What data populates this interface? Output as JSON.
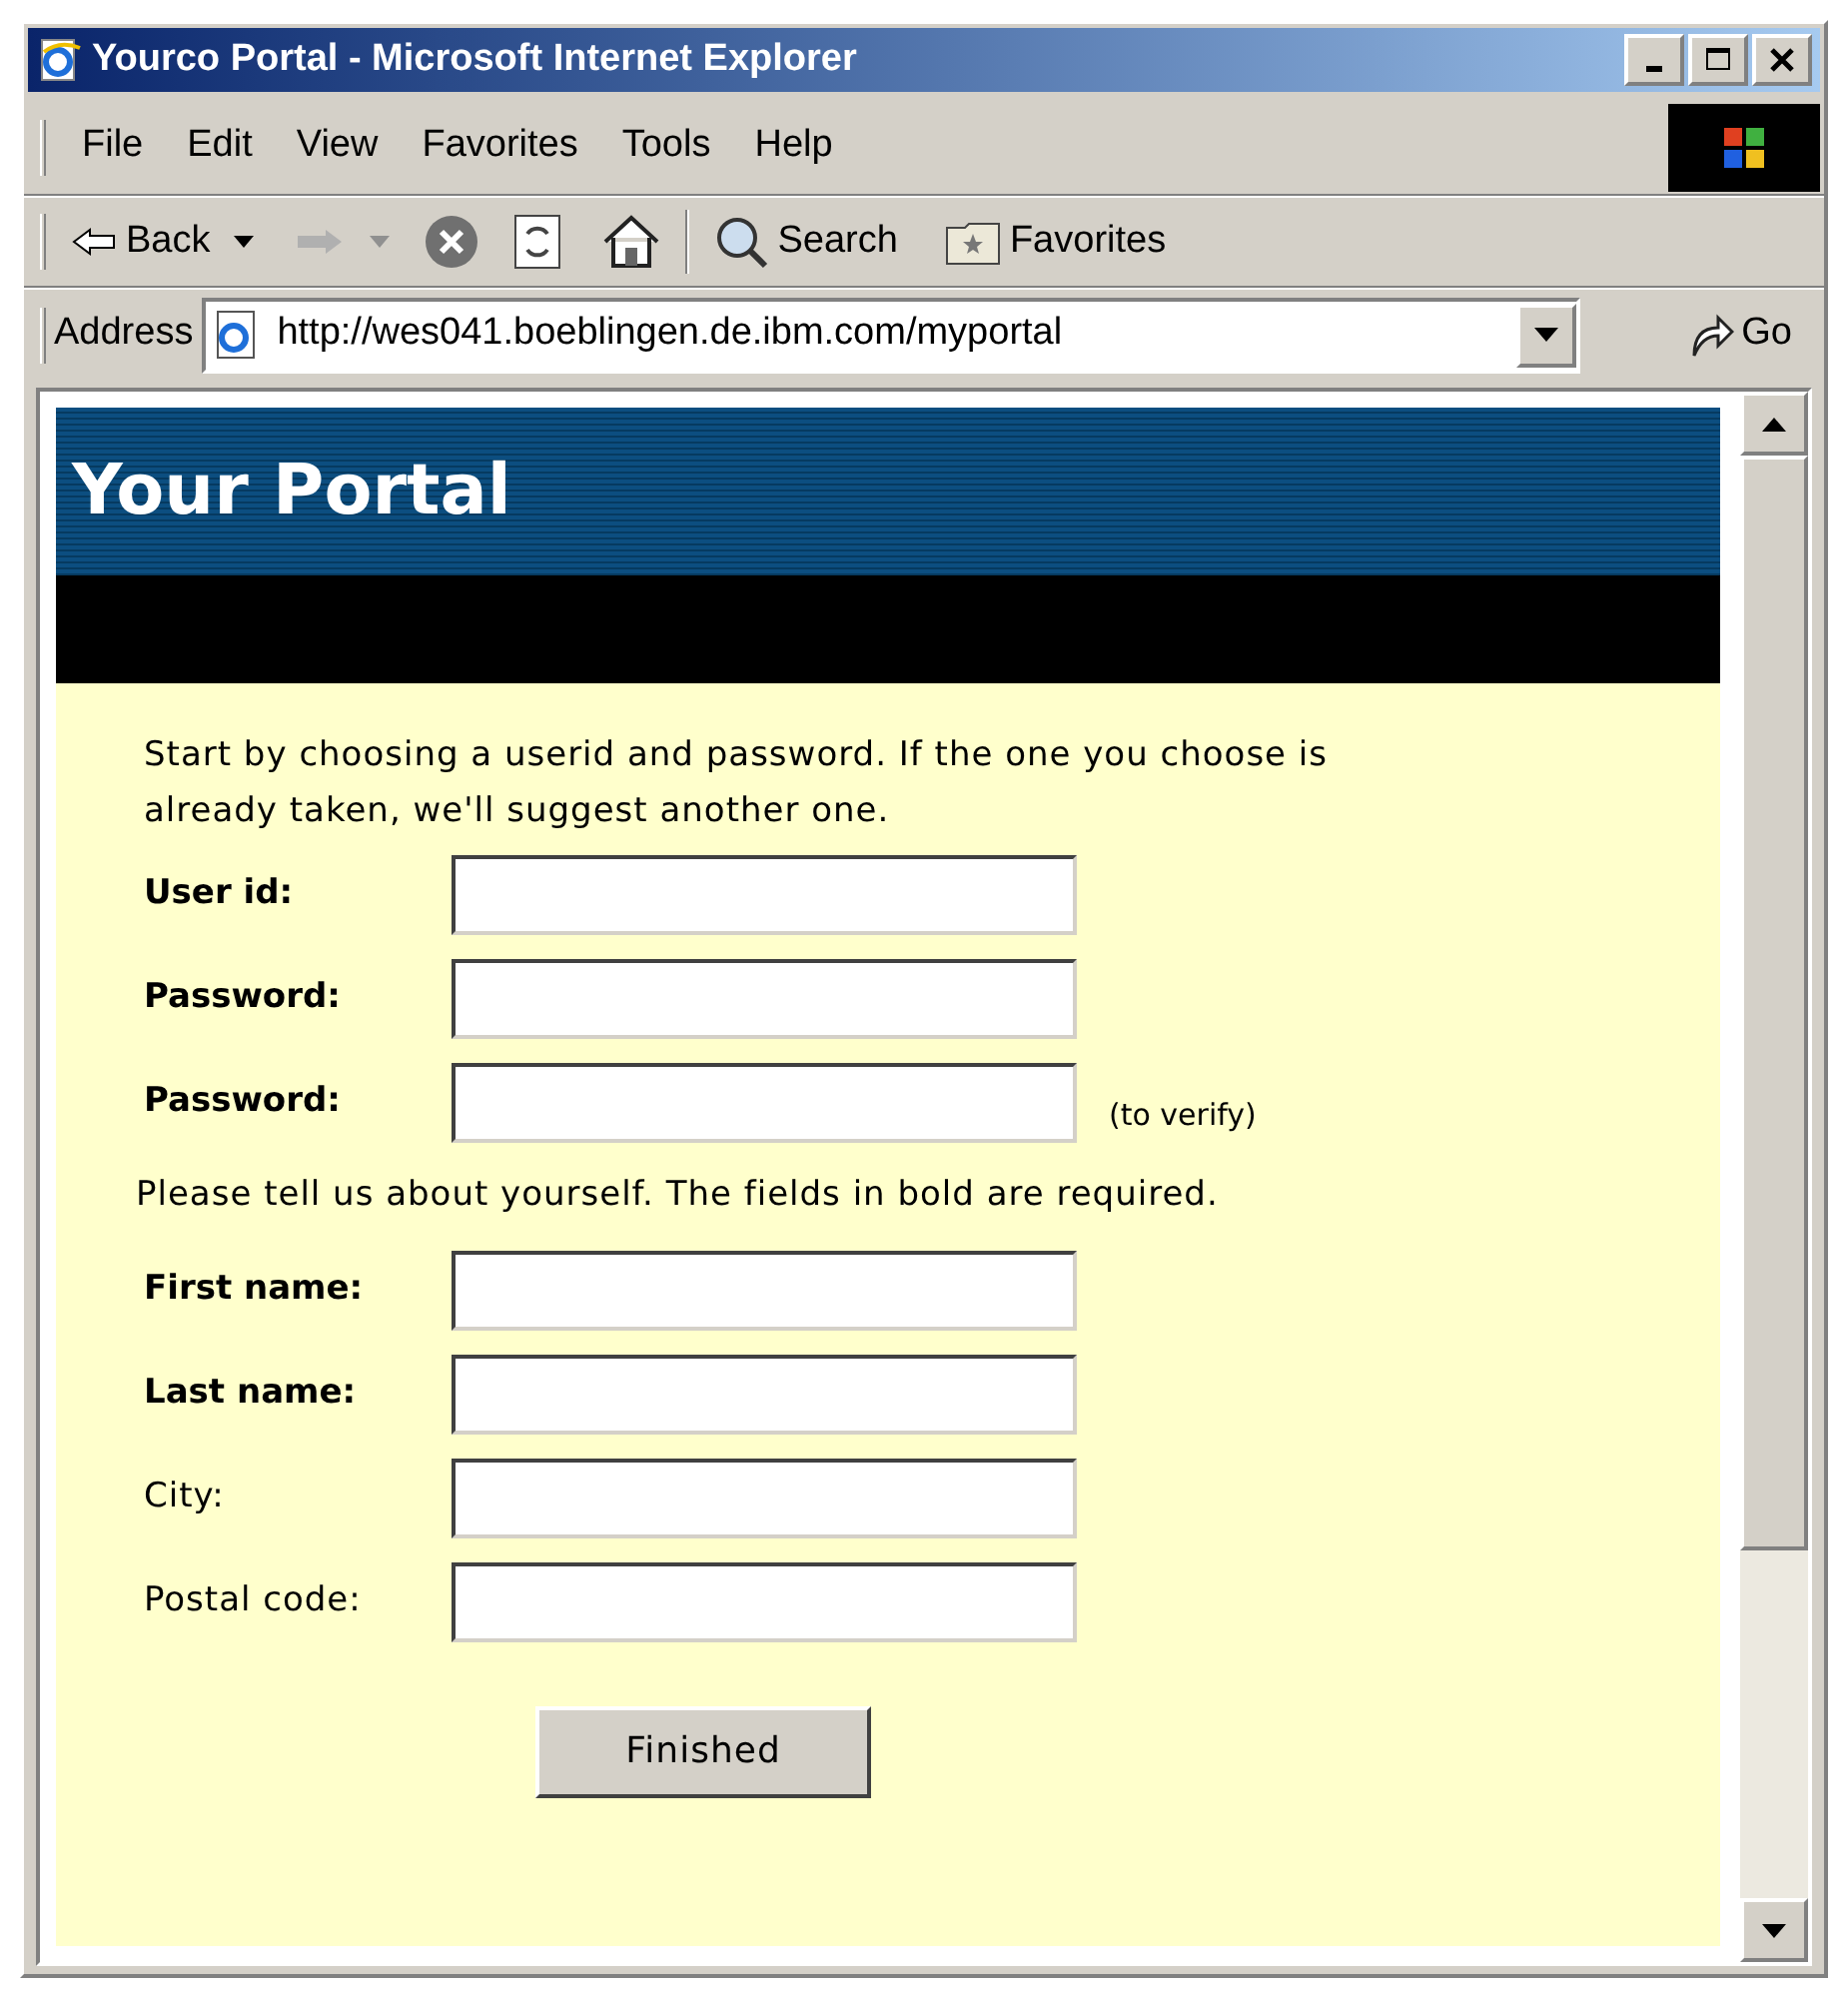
{
  "window": {
    "title": "Yourco Portal - Microsoft Internet Explorer"
  },
  "menu": [
    {
      "label": "File"
    },
    {
      "label": "Edit"
    },
    {
      "label": "View"
    },
    {
      "label": "Favorites"
    },
    {
      "label": "Tools"
    },
    {
      "label": "Help"
    }
  ],
  "toolbar": {
    "back": "Back",
    "search": "Search",
    "favorites": "Favorites"
  },
  "address": {
    "label": "Address",
    "value": "http://wes041.boeblingen.de.ibm.com/myportal",
    "go": "Go"
  },
  "page": {
    "banner_title": "Your Portal",
    "intro": "Start by choosing a userid and password. If the one you choose is already taken, we'll suggest another one.",
    "account_fields": [
      {
        "label": "User id:",
        "required": true
      },
      {
        "label": "Password:",
        "required": true
      },
      {
        "label": "Password:",
        "required": true,
        "hint": "(to verify)"
      }
    ],
    "about": "Please tell us about yourself. The fields in bold are required.",
    "profile_fields": [
      {
        "label": "First name:",
        "required": true
      },
      {
        "label": "Last name:",
        "required": true
      },
      {
        "label": "City:",
        "required": false
      },
      {
        "label": "Postal code:",
        "required": false
      }
    ],
    "submit": "Finished"
  }
}
